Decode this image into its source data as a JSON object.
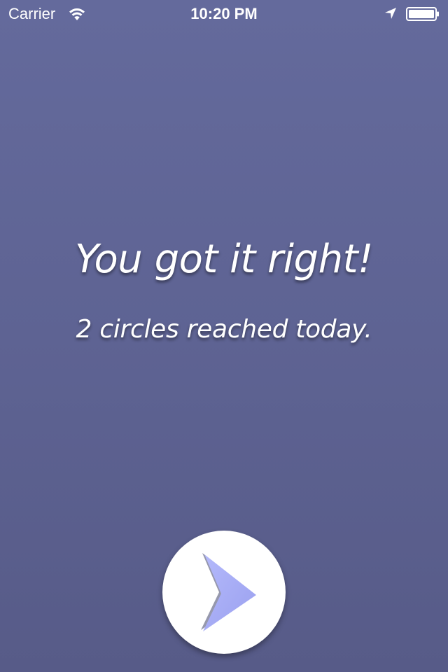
{
  "status_bar": {
    "carrier": "Carrier",
    "time": "10:20 PM",
    "icons": [
      "wifi-icon",
      "location-arrow-icon",
      "battery-icon"
    ]
  },
  "result": {
    "headline": "You got it right!",
    "subline": "2 circles reached today."
  },
  "next_button": {
    "icon": "chevron-right-icon",
    "accent_color": "#a3a9f5"
  },
  "colors": {
    "background_top": "#646a9c",
    "background_bottom": "#575b88",
    "text": "#ffffff",
    "button_fill": "#ffffff"
  }
}
